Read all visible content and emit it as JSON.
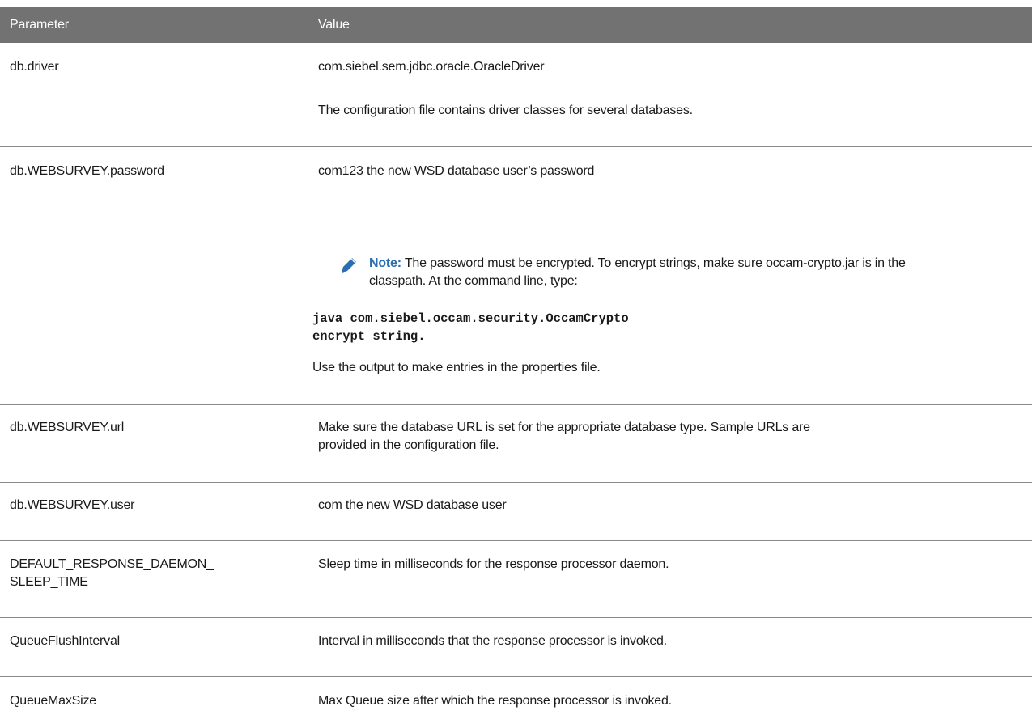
{
  "header": {
    "parameter": "Parameter",
    "value": "Value"
  },
  "rows": [
    {
      "param": "db.driver",
      "value_lines": [
        "com.siebel.sem.jdbc.oracle.OracleDriver",
        "The configuration file contains driver classes for several databases."
      ]
    },
    {
      "param": "db.WEBSURVEY.password",
      "value_lines": [
        "com123 the new WSD database user’s password"
      ],
      "note": {
        "label": "Note:",
        "text": "The password must be encrypted. To encrypt strings, make sure occam-crypto.jar is in the classpath. At the command line, type:",
        "icon": "pencil-icon"
      },
      "code_lines": [
        "java com.siebel.occam.security.OccamCrypto",
        "encrypt string."
      ],
      "after_code": "Use the output to make entries in the properties file."
    },
    {
      "param": "db.WEBSURVEY.url",
      "value_lines": [
        "Make sure the database URL is set for the appropriate database type. Sample URLs are provided in the configuration file."
      ]
    },
    {
      "param": "db.WEBSURVEY.user",
      "value_lines": [
        "com the new WSD database user"
      ]
    },
    {
      "param_lines": [
        "DEFAULT_RESPONSE_DAEMON_",
        "SLEEP_TIME"
      ],
      "value_lines": [
        "Sleep time in milliseconds for the response processor daemon."
      ]
    },
    {
      "param": "QueueFlushInterval",
      "value_lines": [
        "Interval in milliseconds that the response processor is invoked."
      ]
    },
    {
      "param": "QueueMaxSize",
      "value_lines": [
        "Max Queue size after which the response processor is invoked."
      ]
    }
  ],
  "colors": {
    "header_bg": "#727272",
    "header_text": "#ffffff",
    "note_accent": "#2a6fb0",
    "divider": "#8a8a8a"
  }
}
